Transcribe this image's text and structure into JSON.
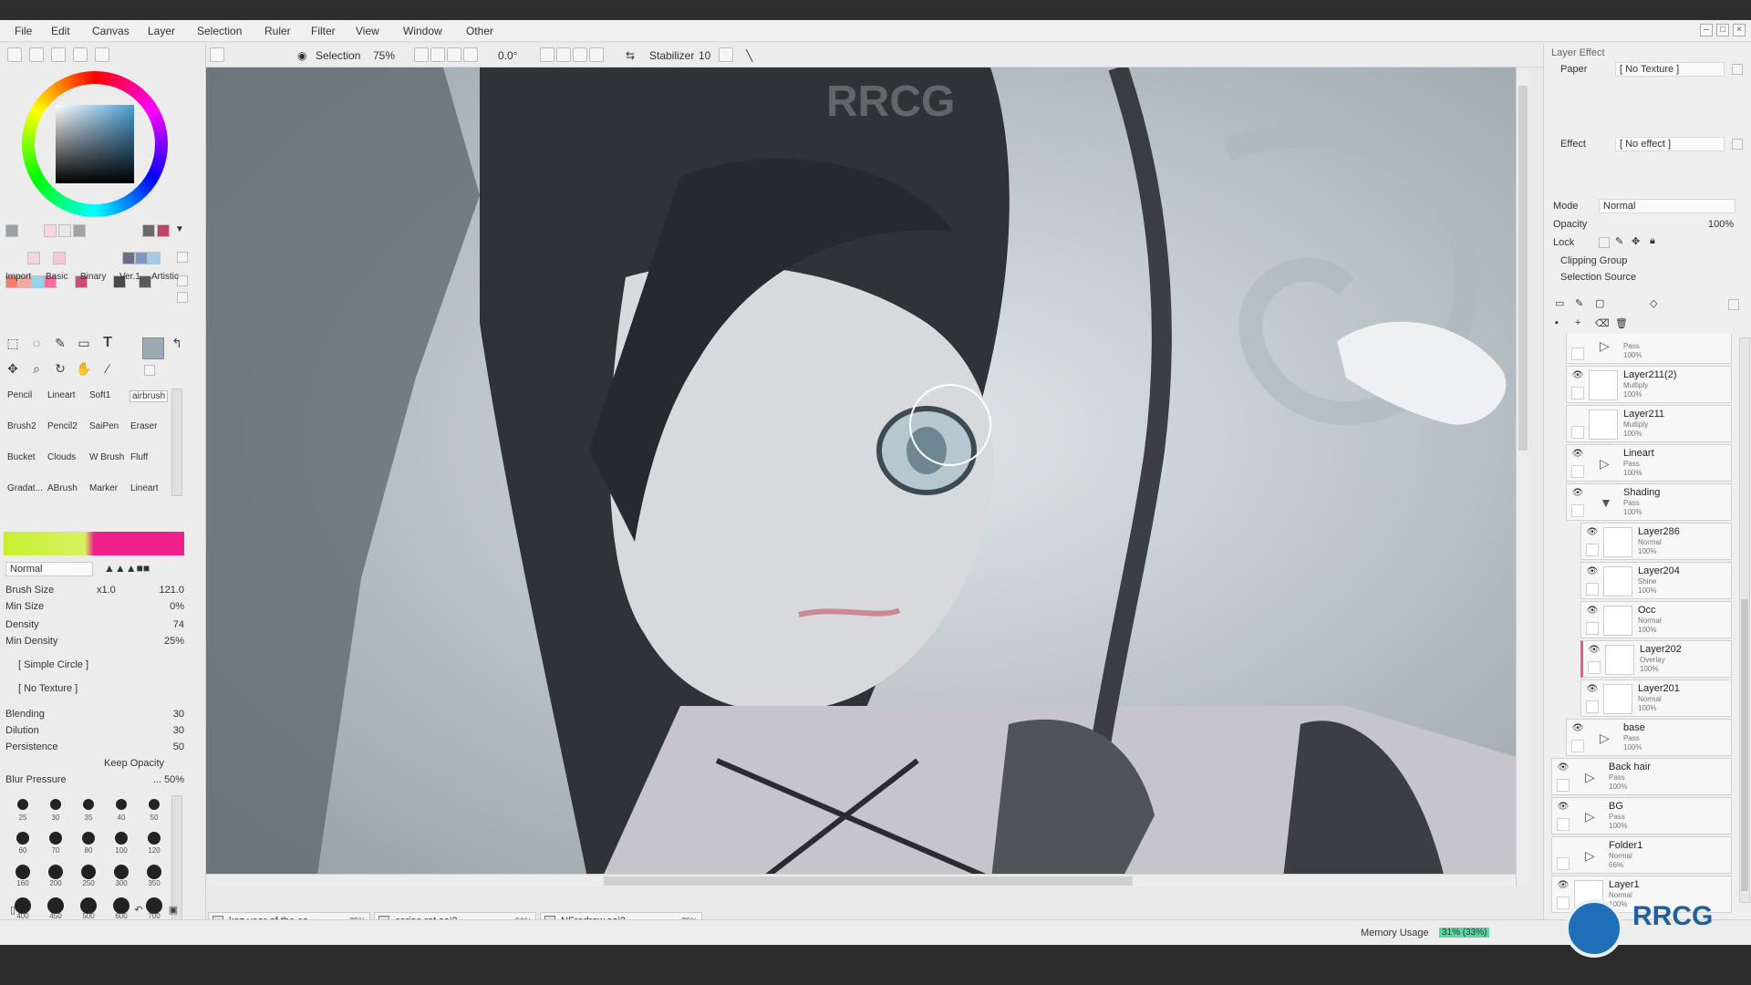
{
  "menu": [
    "File",
    "Edit",
    "Canvas",
    "Layer",
    "Selection",
    "Ruler",
    "Filter",
    "View",
    "Window",
    "Other"
  ],
  "toolbar": {
    "selection_label": "Selection",
    "zoom": "75%",
    "rotation": "0.0°",
    "stabilizer_label": "Stabilizer",
    "stabilizer_value": "10"
  },
  "left": {
    "tool_tabs": [
      "Import",
      "Basic",
      "Binary",
      "Ver.1",
      "Artistic"
    ],
    "brushes_row1": [
      "Pencil",
      "Lineart",
      "Soft1",
      "airbrush"
    ],
    "brushes_row2": [
      "Brush2",
      "Pencil2",
      "SaiPen",
      "Eraser"
    ],
    "brushes_row3": [
      "Bucket",
      "Clouds",
      "W Brush",
      "Fluff"
    ],
    "brushes_row4": [
      "Gradat...",
      "ABrush",
      "Marker",
      "Lineart"
    ],
    "blend_mode": "Normal",
    "brush_size_label": "Brush Size",
    "brush_size_mult": "x1.0",
    "brush_size_value": "121.0",
    "min_size_label": "Min Size",
    "min_size_value": "0%",
    "density_label": "Density",
    "density_value": "74",
    "min_density_label": "Min Density",
    "min_density_value": "25%",
    "shape": "[ Simple Circle ]",
    "texture": "[ No Texture ]",
    "blending_label": "Blending",
    "blending_value": "30",
    "dilution_label": "Dilution",
    "dilution_value": "30",
    "persistence_label": "Persistence",
    "persistence_value": "50",
    "keep_opacity": "Keep Opacity",
    "blur_pressure_label": "Blur Pressure",
    "blur_pressure_value": "... 50%",
    "dot_sizes": [
      "25",
      "30",
      "35",
      "40",
      "50",
      "60",
      "70",
      "80",
      "100",
      "120",
      "160",
      "200",
      "250",
      "300",
      "350",
      "400",
      "450",
      "500",
      "600",
      "700"
    ]
  },
  "files": [
    {
      "name": "kaz year of the co...",
      "zoom": "75%"
    },
    {
      "name": "cerise rat.sai2",
      "zoom": "50%"
    },
    {
      "name": "NFredraw.sai2",
      "zoom": "75%"
    }
  ],
  "right": {
    "section": "Layer Effect",
    "paper_label": "Paper",
    "paper_value": "[ No Texture ]",
    "effect_label": "Effect",
    "effect_value": "[ No effect ]",
    "mode_label": "Mode",
    "mode_value": "Normal",
    "opacity_label": "Opacity",
    "opacity_value": "100%",
    "lock_label": "Lock",
    "clipping_group": "Clipping Group",
    "selection_source": "Selection Source",
    "layers": [
      {
        "name": "",
        "mode": "Pass",
        "opacity": "100%",
        "indent": 1,
        "folder": true,
        "visible": false
      },
      {
        "name": "Layer211(2)",
        "mode": "Multiply",
        "opacity": "100%",
        "indent": 1,
        "folder": false,
        "visible": true
      },
      {
        "name": "Layer211",
        "mode": "Multiply",
        "opacity": "100%",
        "indent": 1,
        "folder": false,
        "visible": false
      },
      {
        "name": "Lineart",
        "mode": "Pass",
        "opacity": "100%",
        "indent": 1,
        "folder": true,
        "visible": true
      },
      {
        "name": "Shading",
        "mode": "Pass",
        "opacity": "100%",
        "indent": 1,
        "folder": true,
        "visible": true
      },
      {
        "name": "Layer286",
        "mode": "Normal",
        "opacity": "100%",
        "indent": 2,
        "folder": false,
        "visible": true
      },
      {
        "name": "Layer204",
        "mode": "Shine",
        "opacity": "100%",
        "indent": 2,
        "folder": false,
        "visible": true
      },
      {
        "name": "Occ",
        "mode": "Normal",
        "opacity": "100%",
        "indent": 2,
        "folder": false,
        "visible": true
      },
      {
        "name": "Layer202",
        "mode": "Overlay",
        "opacity": "100%",
        "indent": 2,
        "folder": false,
        "visible": true
      },
      {
        "name": "Layer201",
        "mode": "Normal",
        "opacity": "100%",
        "indent": 2,
        "folder": false,
        "visible": true
      },
      {
        "name": "base",
        "mode": "Pass",
        "opacity": "100%",
        "indent": 1,
        "folder": true,
        "visible": true
      },
      {
        "name": "Back hair",
        "mode": "Pass",
        "opacity": "100%",
        "indent": 0,
        "folder": true,
        "visible": true
      },
      {
        "name": "BG",
        "mode": "Pass",
        "opacity": "100%",
        "indent": 0,
        "folder": true,
        "visible": true
      },
      {
        "name": "Folder1",
        "mode": "Normal",
        "opacity": "66%",
        "indent": 0,
        "folder": true,
        "visible": false
      },
      {
        "name": "Layer1",
        "mode": "Normal",
        "opacity": "100%",
        "indent": 0,
        "folder": false,
        "visible": true
      }
    ]
  },
  "status": {
    "memory_label": "Memory Usage",
    "memory_value": "31% (33%)"
  },
  "watermark": "RRCG",
  "colors": {
    "accent": "#2a8bd1",
    "fg_gradient_left": "#c8f030",
    "fg_gradient_right": "#f0208a"
  }
}
